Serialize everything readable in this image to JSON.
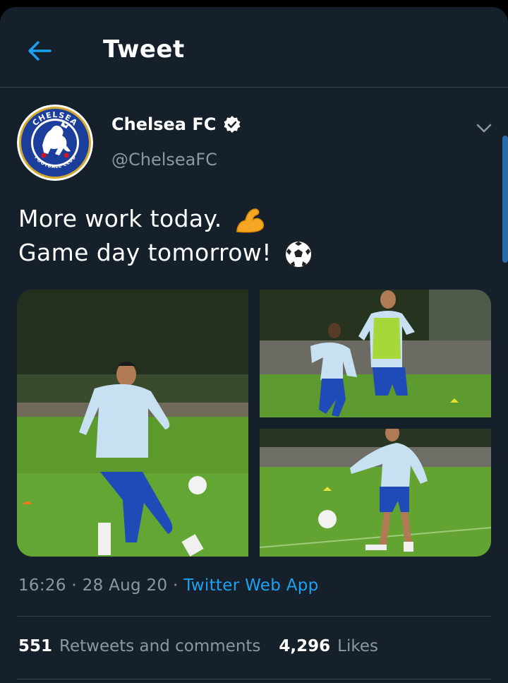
{
  "header": {
    "title": "Tweet"
  },
  "author": {
    "name": "Chelsea FC",
    "handle": "@ChelseaFC"
  },
  "logo": {
    "top_text": "CHELSEA",
    "bottom_text": "FOOTBALL CLUB"
  },
  "tweet": {
    "line1": "More work today.",
    "line2": "Game day tomorrow!"
  },
  "meta": {
    "time": "16:26",
    "date": "28 Aug 20",
    "source": "Twitter Web App",
    "sep": " · "
  },
  "stats": {
    "retweets_count": "551",
    "retweets_label": "Retweets and comments",
    "likes_count": "4,296",
    "likes_label": "Likes"
  },
  "colors": {
    "background": "#15202b",
    "accent": "#1da1f2",
    "muted": "#8899a6",
    "divider": "#38444d"
  },
  "icons": [
    "back-arrow-icon",
    "verified-badge-icon",
    "chevron-down-icon",
    "flexed-biceps-emoji",
    "soccer-ball-emoji"
  ]
}
